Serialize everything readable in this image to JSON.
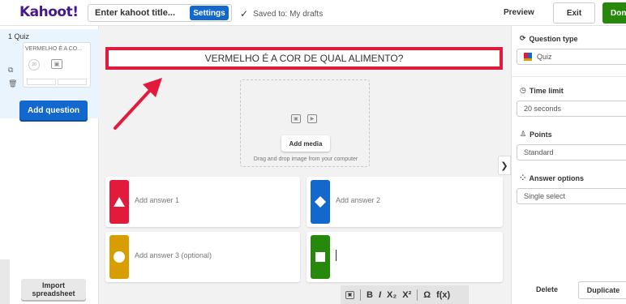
{
  "header": {
    "logo": "Kahoot!",
    "title_placeholder": "Enter kahoot title...",
    "settings_label": "Settings",
    "saved_text": "Saved to: My drafts",
    "preview_label": "Preview",
    "exit_label": "Exit",
    "done_label": "Done"
  },
  "sidebar": {
    "slide_number": "1 Quiz",
    "slide_title": "VERMELHO É A CO...",
    "thumb_timer": "20",
    "add_question_label": "Add question",
    "import_label": "Import spreadsheet"
  },
  "question": {
    "text": "VERMELHO É A COR DE QUAL ALIMENTO?"
  },
  "media": {
    "add_media_label": "Add media",
    "drag_text": "Drag and drop image from your computer"
  },
  "answers": [
    {
      "label": "Add answer 1",
      "color": "#e21b3c",
      "shape": "triangle"
    },
    {
      "label": "Add answer 2",
      "color": "#1368ce",
      "shape": "diamond"
    },
    {
      "label": "Add answer 3 (optional)",
      "color": "#d89e00",
      "shape": "circle"
    },
    {
      "label": "",
      "color": "#26890c",
      "shape": "square"
    }
  ],
  "toolbar": {
    "bold": "B",
    "italic": "I",
    "subscript": "X₂",
    "superscript": "X²",
    "omega": "Ω",
    "function": "f(x)"
  },
  "right_panel": {
    "question_type_label": "Question type",
    "question_type_value": "Quiz",
    "time_limit_label": "Time limit",
    "time_limit_value": "20 seconds",
    "points_label": "Points",
    "points_value": "Standard",
    "answer_options_label": "Answer options",
    "answer_options_value": "Single select",
    "delete_label": "Delete",
    "duplicate_label": "Duplicate"
  },
  "colors": {
    "brand": "#46178f",
    "primary_blue": "#1368ce",
    "done_green": "#26890c",
    "highlight_red": "#e21b3c"
  }
}
